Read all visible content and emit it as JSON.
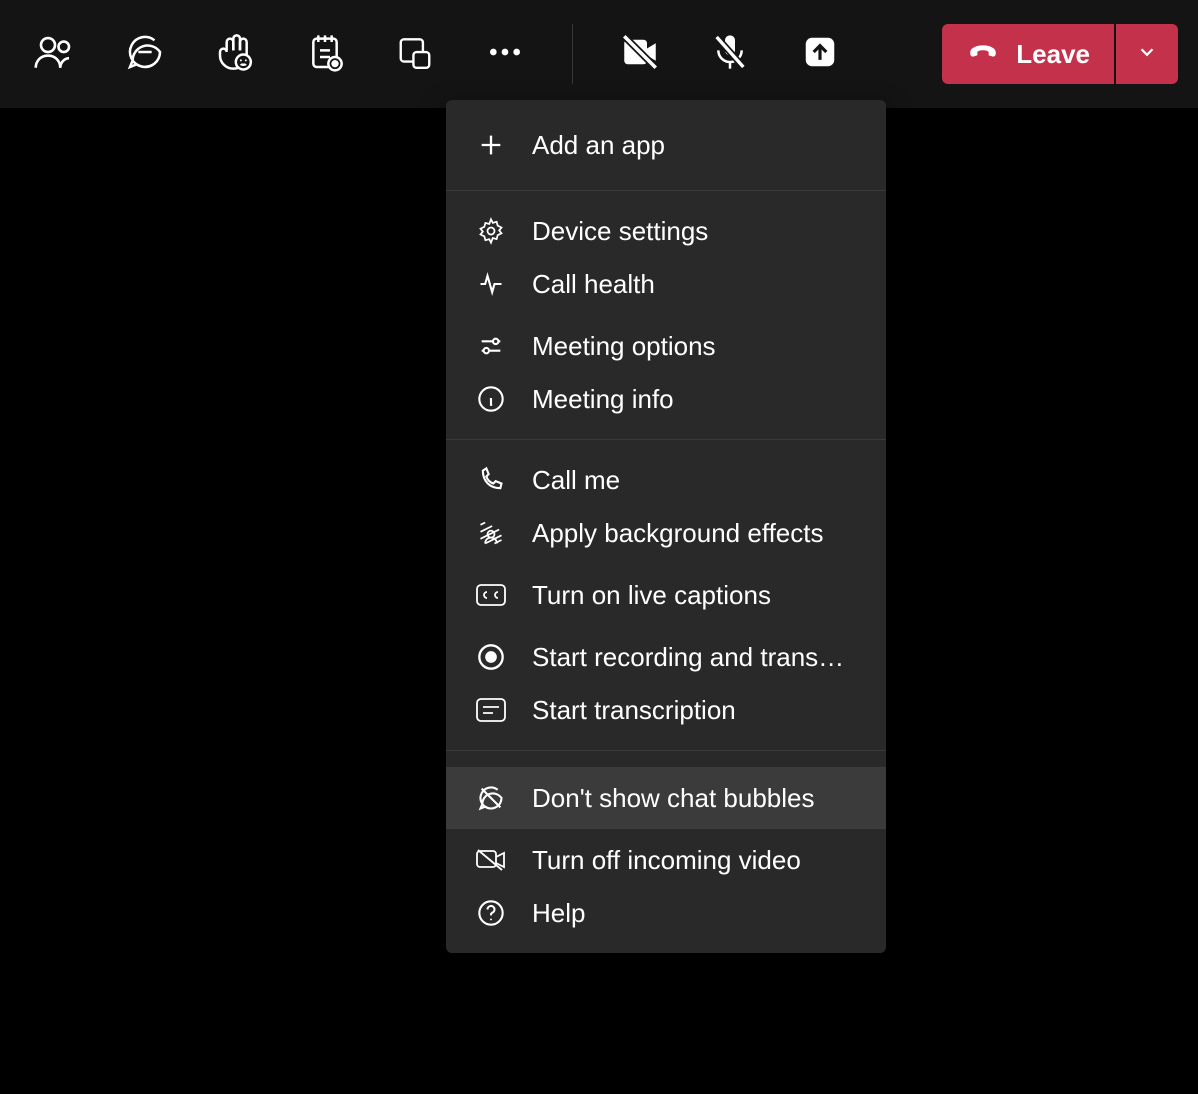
{
  "toolbar": {
    "leave_label": "Leave"
  },
  "menu": {
    "add_app": "Add an app",
    "device_settings": "Device settings",
    "call_health": "Call health",
    "meeting_options": "Meeting options",
    "meeting_info": "Meeting info",
    "call_me": "Call me",
    "background_effects": "Apply background effects",
    "live_captions": "Turn on live captions",
    "start_recording": "Start recording and transc…",
    "start_transcription": "Start transcription",
    "chat_bubbles": "Don't show chat bubbles",
    "incoming_video": "Turn off incoming video",
    "help": "Help"
  },
  "colors": {
    "accent": "#7b83eb",
    "leave": "#c4314b",
    "panel": "#292929",
    "toolbar": "#141414"
  }
}
